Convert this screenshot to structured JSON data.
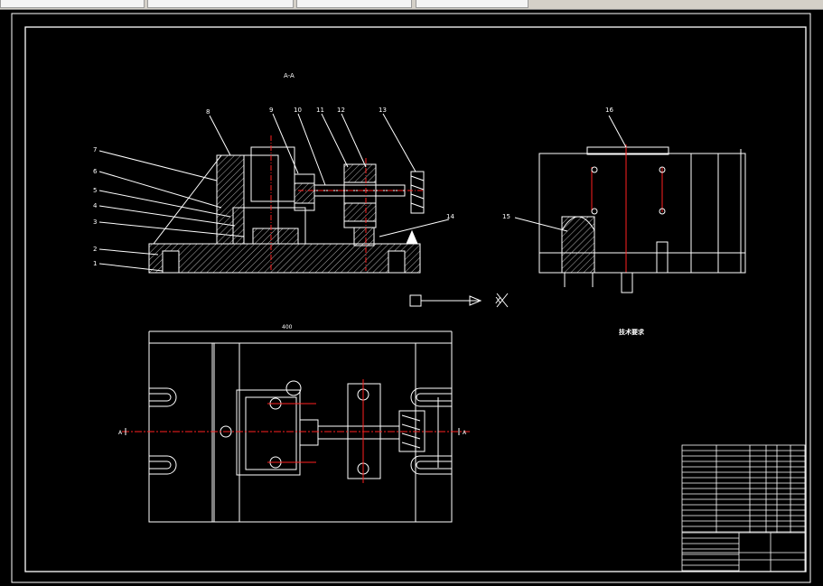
{
  "tabs": [
    {
      "label": ""
    },
    {
      "label": ""
    },
    {
      "label": ""
    },
    {
      "label": ""
    }
  ],
  "colors": {
    "background": "#000000",
    "line": "#ffffff",
    "center_line": "#ff2020",
    "tabbar": "#d4d0c8"
  },
  "drawing": {
    "section_label": "A-A",
    "part_numbers": [
      "1",
      "2",
      "3",
      "4",
      "5",
      "6",
      "7",
      "8",
      "9",
      "10",
      "11",
      "12",
      "13",
      "14",
      "15",
      "16"
    ],
    "axis_label_x": "X",
    "section_mark_left": "A",
    "section_mark_right": "A",
    "dimension_plan_width": "400",
    "tech_requirements_title": "技术要求",
    "tech_requirements_lines": [
      "",
      "",
      "",
      ""
    ]
  }
}
